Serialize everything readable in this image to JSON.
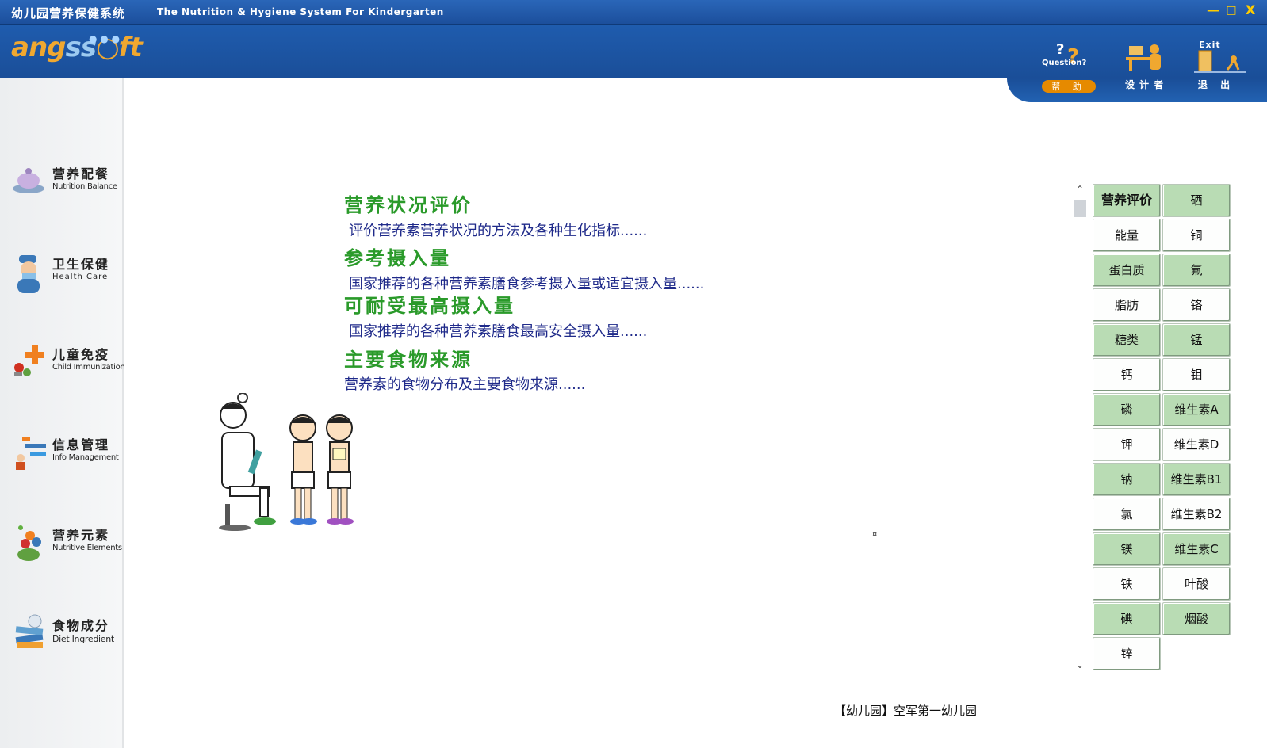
{
  "window": {
    "title_cn": "幼儿园营养保健系统",
    "title_en": "The Nutrition & Hygiene System For Kindergarten",
    "minimize": "—",
    "maximize": "□",
    "close": "X"
  },
  "logo": {
    "prefix": "ang",
    "mid": "ss",
    "suffix": "ft"
  },
  "toolbar": {
    "help": {
      "top": "Question?",
      "label": "帮 助"
    },
    "designer": {
      "label": "设计者"
    },
    "exit": {
      "top": "Exit",
      "label": "退 出"
    }
  },
  "sidebar": {
    "items": [
      {
        "cn": "营养配餐",
        "en": "Nutrition Balance"
      },
      {
        "cn": "卫生保健",
        "en": "Health  Care"
      },
      {
        "cn": "儿童免疫",
        "en": "Child Immunization"
      },
      {
        "cn": "信息管理",
        "en": "Info Management"
      },
      {
        "cn": "营养元素",
        "en": "Nutritive Elements"
      },
      {
        "cn": "食物成分",
        "en": "Diet Ingredient"
      }
    ]
  },
  "content": {
    "sections": [
      {
        "title": "营养状况评价",
        "desc": "评价营养素营养状况的方法及各种生化指标......"
      },
      {
        "title": "参考摄入量",
        "desc": "国家推荐的各种营养素膳食参考摄入量或适宜摄入量......"
      },
      {
        "title": "可耐受最高摄入量",
        "desc": "国家推荐的各种营养素膳食最高安全摄入量......"
      },
      {
        "title": "主要食物来源",
        "desc": "营养素的食物分布及主要食物来源......"
      }
    ],
    "marker": "¤"
  },
  "nutrients": {
    "left": [
      "营养评价",
      "能量",
      "蛋白质",
      "脂肪",
      "糖类",
      "钙",
      "磷",
      "钾",
      "钠",
      "氯",
      "镁",
      "铁",
      "碘",
      "锌"
    ],
    "right": [
      "硒",
      "铜",
      "氟",
      "铬",
      "锰",
      "钼",
      "维生素A",
      "维生素D",
      "维生素B1",
      "维生素B2",
      "维生素C",
      "叶酸",
      "烟酸"
    ]
  },
  "footer": {
    "kindergarten": "【幼儿园】空军第一幼儿园"
  },
  "colors": {
    "title_bar": "#1c4f9c",
    "accent_green": "#2a9a2a",
    "desc_blue": "#1f2a8a",
    "cell_green": "#b9dcb4"
  }
}
